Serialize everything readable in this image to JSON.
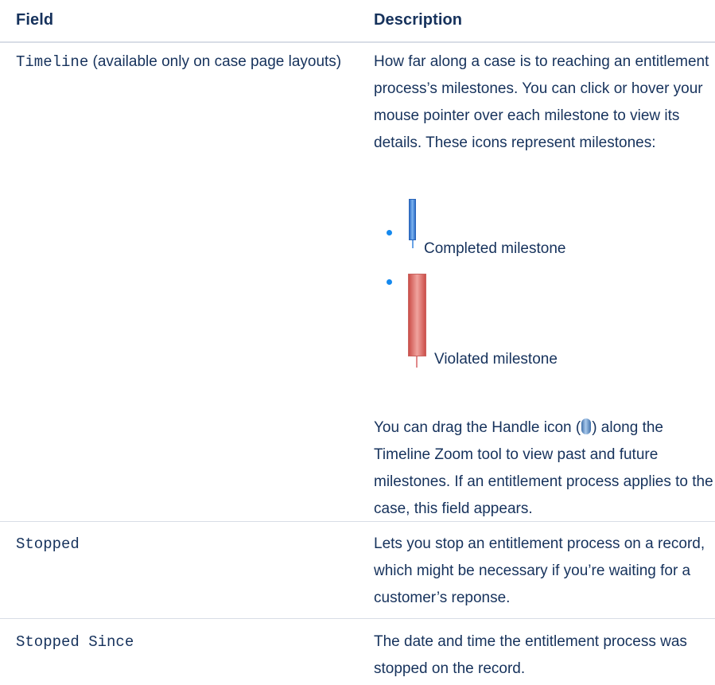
{
  "table": {
    "headers": {
      "field": "Field",
      "description": "Description"
    },
    "rows": [
      {
        "field_code": "Timeline",
        "field_note": " (available only on case page layouts)",
        "description_intro": "How far along a case is to reaching an entitlement process’s milestones. You can click or hover your mouse pointer over each milestone to view its details. These icons represent milestones:",
        "milestones": [
          {
            "label": "Completed milestone",
            "color": "#4a8fe0",
            "icon": "completed-milestone-icon"
          },
          {
            "label": "Violated milestone",
            "color": "#d9605b",
            "icon": "violated-milestone-icon"
          }
        ],
        "description_before_handle": "You can drag the Handle icon (",
        "description_after_handle": ") along the Timeline Zoom tool to view past and future milestones. If an entitlement process applies to the case, this field appears."
      },
      {
        "field_code": "Stopped",
        "description": "Lets you stop an entitlement process on a record, which might be necessary if you’re waiting for a customer’s reponse."
      },
      {
        "field_code": "Stopped Since",
        "description": "The date and time the entitlement process was stopped on the record."
      }
    ]
  },
  "colors": {
    "text": "#16325c",
    "divider": "#d8dde6",
    "bullet": "#1589ee"
  }
}
